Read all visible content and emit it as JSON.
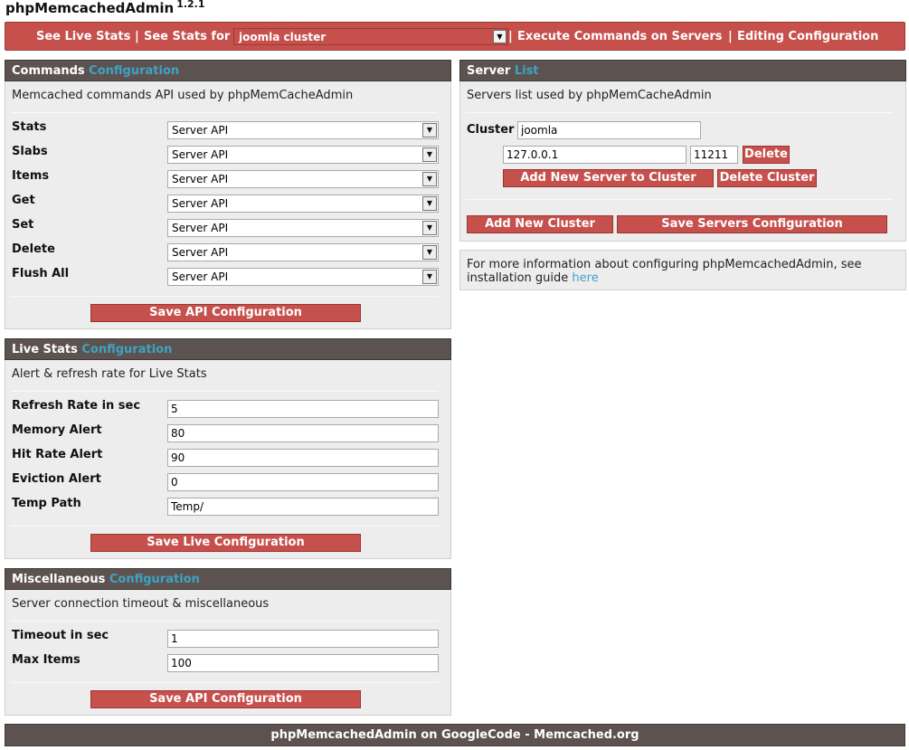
{
  "app": {
    "name": "phpMemcachedAdmin",
    "version": "1.2.1"
  },
  "nav": {
    "live_stats": "See Live Stats",
    "sep": "|",
    "stats_for": "See Stats for",
    "cluster_selected": "joomla cluster",
    "execute_commands": "Execute Commands on Servers",
    "editing_configuration": "Editing Configuration"
  },
  "commands_panel": {
    "title_main": "Commands",
    "title_accent": "Configuration",
    "description": "Memcached commands API used by phpMemCacheAdmin",
    "rows": [
      {
        "label": "Stats",
        "value": "Server API"
      },
      {
        "label": "Slabs",
        "value": "Server API"
      },
      {
        "label": "Items",
        "value": "Server API"
      },
      {
        "label": "Get",
        "value": "Server API"
      },
      {
        "label": "Set",
        "value": "Server API"
      },
      {
        "label": "Delete",
        "value": "Server API"
      },
      {
        "label": "Flush All",
        "value": "Server API"
      }
    ],
    "save_button": "Save API Configuration"
  },
  "live_stats_panel": {
    "title_main": "Live Stats",
    "title_accent": "Configuration",
    "description": "Alert & refresh rate for Live Stats",
    "rows": [
      {
        "label": "Refresh Rate in sec",
        "value": "5"
      },
      {
        "label": "Memory Alert",
        "value": "80"
      },
      {
        "label": "Hit Rate Alert",
        "value": "90"
      },
      {
        "label": "Eviction Alert",
        "value": "0"
      },
      {
        "label": "Temp Path",
        "value": "Temp/"
      }
    ],
    "save_button": "Save Live Configuration"
  },
  "misc_panel": {
    "title_main": "Miscellaneous",
    "title_accent": "Configuration",
    "description": "Server connection timeout & miscellaneous",
    "rows": [
      {
        "label": "Timeout in sec",
        "value": "1"
      },
      {
        "label": "Max Items",
        "value": "100"
      }
    ],
    "save_button": "Save API Configuration"
  },
  "server_panel": {
    "title_main": "Server",
    "title_accent": "List",
    "description": "Servers list used by phpMemCacheAdmin",
    "cluster_label": "Cluster",
    "cluster_name": "joomla",
    "server_host": "127.0.0.1",
    "server_port": "11211",
    "delete_button": "Delete",
    "add_server_button": "Add New Server to Cluster",
    "delete_cluster_button": "Delete Cluster",
    "add_cluster_button": "Add New Cluster",
    "save_servers_button": "Save Servers Configuration"
  },
  "info_panel": {
    "text": "For more information about configuring phpMemcachedAdmin, see installation guide",
    "link": "here"
  },
  "footer": {
    "text": "phpMemcachedAdmin on GoogleCode - Memcached.org"
  }
}
